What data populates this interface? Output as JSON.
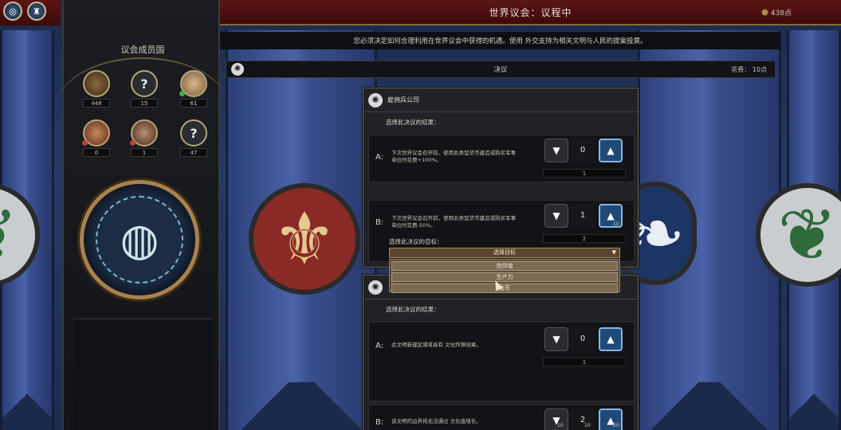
{
  "header": {
    "title": "世界议会：议程中",
    "points": "438点"
  },
  "instruction": "您必须决定如何合理利用在世界议会中获得的机遇。使用 外交支持为相关文明与人民的提案投票。",
  "resolutions_header": {
    "label": "决议",
    "cost": "花费： 10点"
  },
  "sidebar": {
    "title": "议会成员国",
    "members": [
      {
        "symbol": "",
        "value": "448"
      },
      {
        "symbol": "?",
        "value": "15"
      },
      {
        "symbol": "",
        "value": "61"
      },
      {
        "symbol": "",
        "value": "0"
      },
      {
        "symbol": "",
        "value": "1"
      },
      {
        "symbol": "?",
        "value": "47"
      }
    ]
  },
  "card1": {
    "title": "雇佣兵公司",
    "subtitle": "选择此决议的结果：",
    "optA": {
      "letter": "A:",
      "text": "下次世界议会召开前，使用此类型货币建造或购买军事单位时花费+100%。",
      "count": "0",
      "votes": "1"
    },
    "optB": {
      "letter": "B:",
      "text": "下次世界议会召开前，使用此类型货币建造或购买军事单位时花费-50%。",
      "count": "1",
      "votes": "2",
      "up_note": "10"
    },
    "target_label": "选择此决议的目标：",
    "dropdown": {
      "selected": "选择目标",
      "options": [
        "信仰值",
        "生产力",
        "金币"
      ]
    }
  },
  "card2": {
    "subtitle": "选择此决议的结果：",
    "optA": {
      "letter": "A:",
      "text": "此文明新建区域将具有 文化炸弹效果。",
      "count": "0",
      "votes": "1"
    },
    "optB": {
      "letter": "B:",
      "text": "该文明的边界将无法通过 文化值增长。",
      "count": "2",
      "down_note": "10",
      "mid_note": "10",
      "up_note": "20"
    }
  },
  "colors": {
    "topbar": "#5e1414",
    "vote_up": "#1f4a78",
    "card_border": "#6d6450"
  }
}
